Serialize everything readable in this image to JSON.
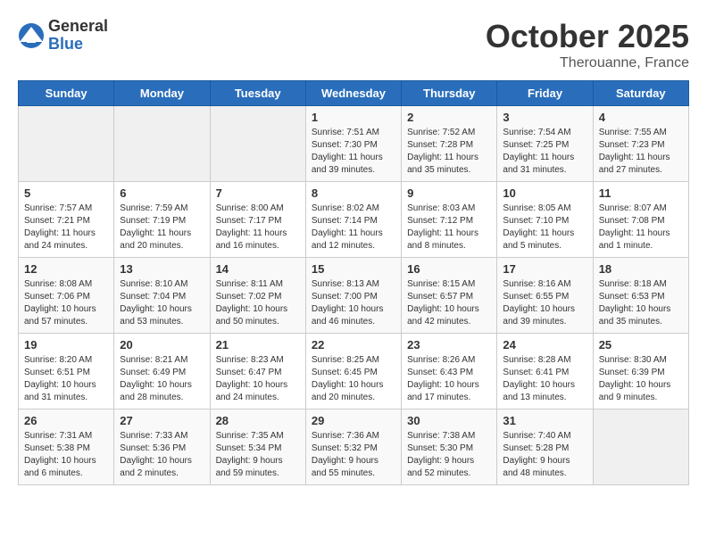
{
  "header": {
    "logo_general": "General",
    "logo_blue": "Blue",
    "month": "October 2025",
    "location": "Therouanne, France"
  },
  "days_of_week": [
    "Sunday",
    "Monday",
    "Tuesday",
    "Wednesday",
    "Thursday",
    "Friday",
    "Saturday"
  ],
  "weeks": [
    [
      {
        "day": "",
        "info": ""
      },
      {
        "day": "",
        "info": ""
      },
      {
        "day": "",
        "info": ""
      },
      {
        "day": "1",
        "info": "Sunrise: 7:51 AM\nSunset: 7:30 PM\nDaylight: 11 hours\nand 39 minutes."
      },
      {
        "day": "2",
        "info": "Sunrise: 7:52 AM\nSunset: 7:28 PM\nDaylight: 11 hours\nand 35 minutes."
      },
      {
        "day": "3",
        "info": "Sunrise: 7:54 AM\nSunset: 7:25 PM\nDaylight: 11 hours\nand 31 minutes."
      },
      {
        "day": "4",
        "info": "Sunrise: 7:55 AM\nSunset: 7:23 PM\nDaylight: 11 hours\nand 27 minutes."
      }
    ],
    [
      {
        "day": "5",
        "info": "Sunrise: 7:57 AM\nSunset: 7:21 PM\nDaylight: 11 hours\nand 24 minutes."
      },
      {
        "day": "6",
        "info": "Sunrise: 7:59 AM\nSunset: 7:19 PM\nDaylight: 11 hours\nand 20 minutes."
      },
      {
        "day": "7",
        "info": "Sunrise: 8:00 AM\nSunset: 7:17 PM\nDaylight: 11 hours\nand 16 minutes."
      },
      {
        "day": "8",
        "info": "Sunrise: 8:02 AM\nSunset: 7:14 PM\nDaylight: 11 hours\nand 12 minutes."
      },
      {
        "day": "9",
        "info": "Sunrise: 8:03 AM\nSunset: 7:12 PM\nDaylight: 11 hours\nand 8 minutes."
      },
      {
        "day": "10",
        "info": "Sunrise: 8:05 AM\nSunset: 7:10 PM\nDaylight: 11 hours\nand 5 minutes."
      },
      {
        "day": "11",
        "info": "Sunrise: 8:07 AM\nSunset: 7:08 PM\nDaylight: 11 hours\nand 1 minute."
      }
    ],
    [
      {
        "day": "12",
        "info": "Sunrise: 8:08 AM\nSunset: 7:06 PM\nDaylight: 10 hours\nand 57 minutes."
      },
      {
        "day": "13",
        "info": "Sunrise: 8:10 AM\nSunset: 7:04 PM\nDaylight: 10 hours\nand 53 minutes."
      },
      {
        "day": "14",
        "info": "Sunrise: 8:11 AM\nSunset: 7:02 PM\nDaylight: 10 hours\nand 50 minutes."
      },
      {
        "day": "15",
        "info": "Sunrise: 8:13 AM\nSunset: 7:00 PM\nDaylight: 10 hours\nand 46 minutes."
      },
      {
        "day": "16",
        "info": "Sunrise: 8:15 AM\nSunset: 6:57 PM\nDaylight: 10 hours\nand 42 minutes."
      },
      {
        "day": "17",
        "info": "Sunrise: 8:16 AM\nSunset: 6:55 PM\nDaylight: 10 hours\nand 39 minutes."
      },
      {
        "day": "18",
        "info": "Sunrise: 8:18 AM\nSunset: 6:53 PM\nDaylight: 10 hours\nand 35 minutes."
      }
    ],
    [
      {
        "day": "19",
        "info": "Sunrise: 8:20 AM\nSunset: 6:51 PM\nDaylight: 10 hours\nand 31 minutes."
      },
      {
        "day": "20",
        "info": "Sunrise: 8:21 AM\nSunset: 6:49 PM\nDaylight: 10 hours\nand 28 minutes."
      },
      {
        "day": "21",
        "info": "Sunrise: 8:23 AM\nSunset: 6:47 PM\nDaylight: 10 hours\nand 24 minutes."
      },
      {
        "day": "22",
        "info": "Sunrise: 8:25 AM\nSunset: 6:45 PM\nDaylight: 10 hours\nand 20 minutes."
      },
      {
        "day": "23",
        "info": "Sunrise: 8:26 AM\nSunset: 6:43 PM\nDaylight: 10 hours\nand 17 minutes."
      },
      {
        "day": "24",
        "info": "Sunrise: 8:28 AM\nSunset: 6:41 PM\nDaylight: 10 hours\nand 13 minutes."
      },
      {
        "day": "25",
        "info": "Sunrise: 8:30 AM\nSunset: 6:39 PM\nDaylight: 10 hours\nand 9 minutes."
      }
    ],
    [
      {
        "day": "26",
        "info": "Sunrise: 7:31 AM\nSunset: 5:38 PM\nDaylight: 10 hours\nand 6 minutes."
      },
      {
        "day": "27",
        "info": "Sunrise: 7:33 AM\nSunset: 5:36 PM\nDaylight: 10 hours\nand 2 minutes."
      },
      {
        "day": "28",
        "info": "Sunrise: 7:35 AM\nSunset: 5:34 PM\nDaylight: 9 hours\nand 59 minutes."
      },
      {
        "day": "29",
        "info": "Sunrise: 7:36 AM\nSunset: 5:32 PM\nDaylight: 9 hours\nand 55 minutes."
      },
      {
        "day": "30",
        "info": "Sunrise: 7:38 AM\nSunset: 5:30 PM\nDaylight: 9 hours\nand 52 minutes."
      },
      {
        "day": "31",
        "info": "Sunrise: 7:40 AM\nSunset: 5:28 PM\nDaylight: 9 hours\nand 48 minutes."
      },
      {
        "day": "",
        "info": ""
      }
    ]
  ]
}
